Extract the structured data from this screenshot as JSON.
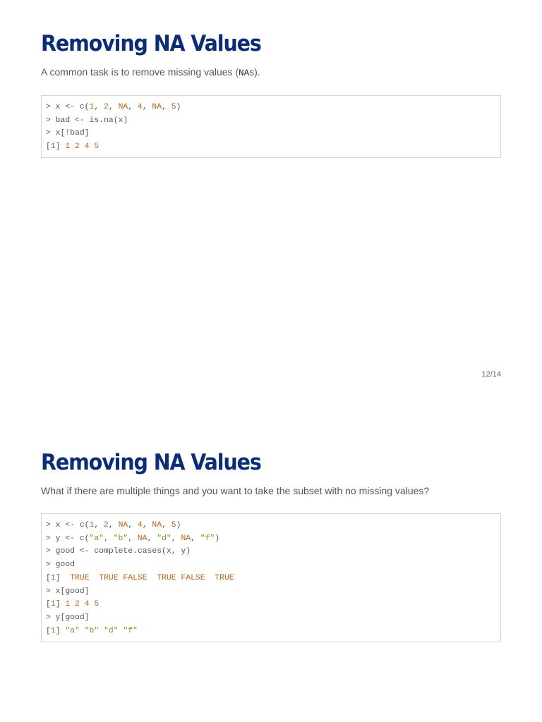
{
  "slides": [
    {
      "title": "Removing NA Values",
      "para_before": "A common task is to remove missing values (",
      "para_code": "NA",
      "para_after": "s).",
      "code": [
        [
          [
            "> x <- c(",
            "p"
          ],
          [
            "1",
            "n"
          ],
          [
            ", ",
            "p"
          ],
          [
            "2",
            "n"
          ],
          [
            ", ",
            "p"
          ],
          [
            "NA",
            "n"
          ],
          [
            ", ",
            "p"
          ],
          [
            "4",
            "n"
          ],
          [
            ", ",
            "p"
          ],
          [
            "NA",
            "n"
          ],
          [
            ", ",
            "p"
          ],
          [
            "5",
            "n"
          ],
          [
            ")",
            "p"
          ]
        ],
        [
          [
            "> bad <- is.na(x)",
            "p"
          ]
        ],
        [
          [
            "> x[!bad]",
            "p"
          ]
        ],
        [
          [
            "[",
            "p"
          ],
          [
            "1",
            "n"
          ],
          [
            "] ",
            "p"
          ],
          [
            "1 2 4 5",
            "n"
          ]
        ]
      ]
    },
    {
      "title": "Removing NA Values",
      "para_before": "What if there are multiple things and you want to take the subset with no missing values?",
      "code": [
        [
          [
            "> x <- c(",
            "p"
          ],
          [
            "1",
            "n"
          ],
          [
            ", ",
            "p"
          ],
          [
            "2",
            "n"
          ],
          [
            ", ",
            "p"
          ],
          [
            "NA",
            "n"
          ],
          [
            ", ",
            "p"
          ],
          [
            "4",
            "n"
          ],
          [
            ", ",
            "p"
          ],
          [
            "NA",
            "n"
          ],
          [
            ", ",
            "p"
          ],
          [
            "5",
            "n"
          ],
          [
            ")",
            "p"
          ]
        ],
        [
          [
            "> y <- c(",
            "p"
          ],
          [
            "\"a\"",
            "s"
          ],
          [
            ", ",
            "p"
          ],
          [
            "\"b\"",
            "s"
          ],
          [
            ", ",
            "p"
          ],
          [
            "NA",
            "n"
          ],
          [
            ", ",
            "p"
          ],
          [
            "\"d\"",
            "s"
          ],
          [
            ", ",
            "p"
          ],
          [
            "NA",
            "n"
          ],
          [
            ", ",
            "p"
          ],
          [
            "\"f\"",
            "s"
          ],
          [
            ")",
            "p"
          ]
        ],
        [
          [
            "> good <- complete.cases(x, y)",
            "p"
          ]
        ],
        [
          [
            "> good",
            "p"
          ]
        ],
        [
          [
            "[",
            "p"
          ],
          [
            "1",
            "n"
          ],
          [
            "]  ",
            "p"
          ],
          [
            "TRUE  TRUE FALSE  TRUE FALSE  TRUE",
            "n"
          ]
        ],
        [
          [
            "> x[good]",
            "p"
          ]
        ],
        [
          [
            "[",
            "p"
          ],
          [
            "1",
            "n"
          ],
          [
            "] ",
            "p"
          ],
          [
            "1 2 4 5",
            "n"
          ]
        ],
        [
          [
            "> y[good]",
            "p"
          ]
        ],
        [
          [
            "[",
            "p"
          ],
          [
            "1",
            "n"
          ],
          [
            "] ",
            "p"
          ],
          [
            "\"a\" \"b\" \"d\" \"f\"",
            "s"
          ]
        ]
      ]
    }
  ],
  "page_number": "12/14"
}
